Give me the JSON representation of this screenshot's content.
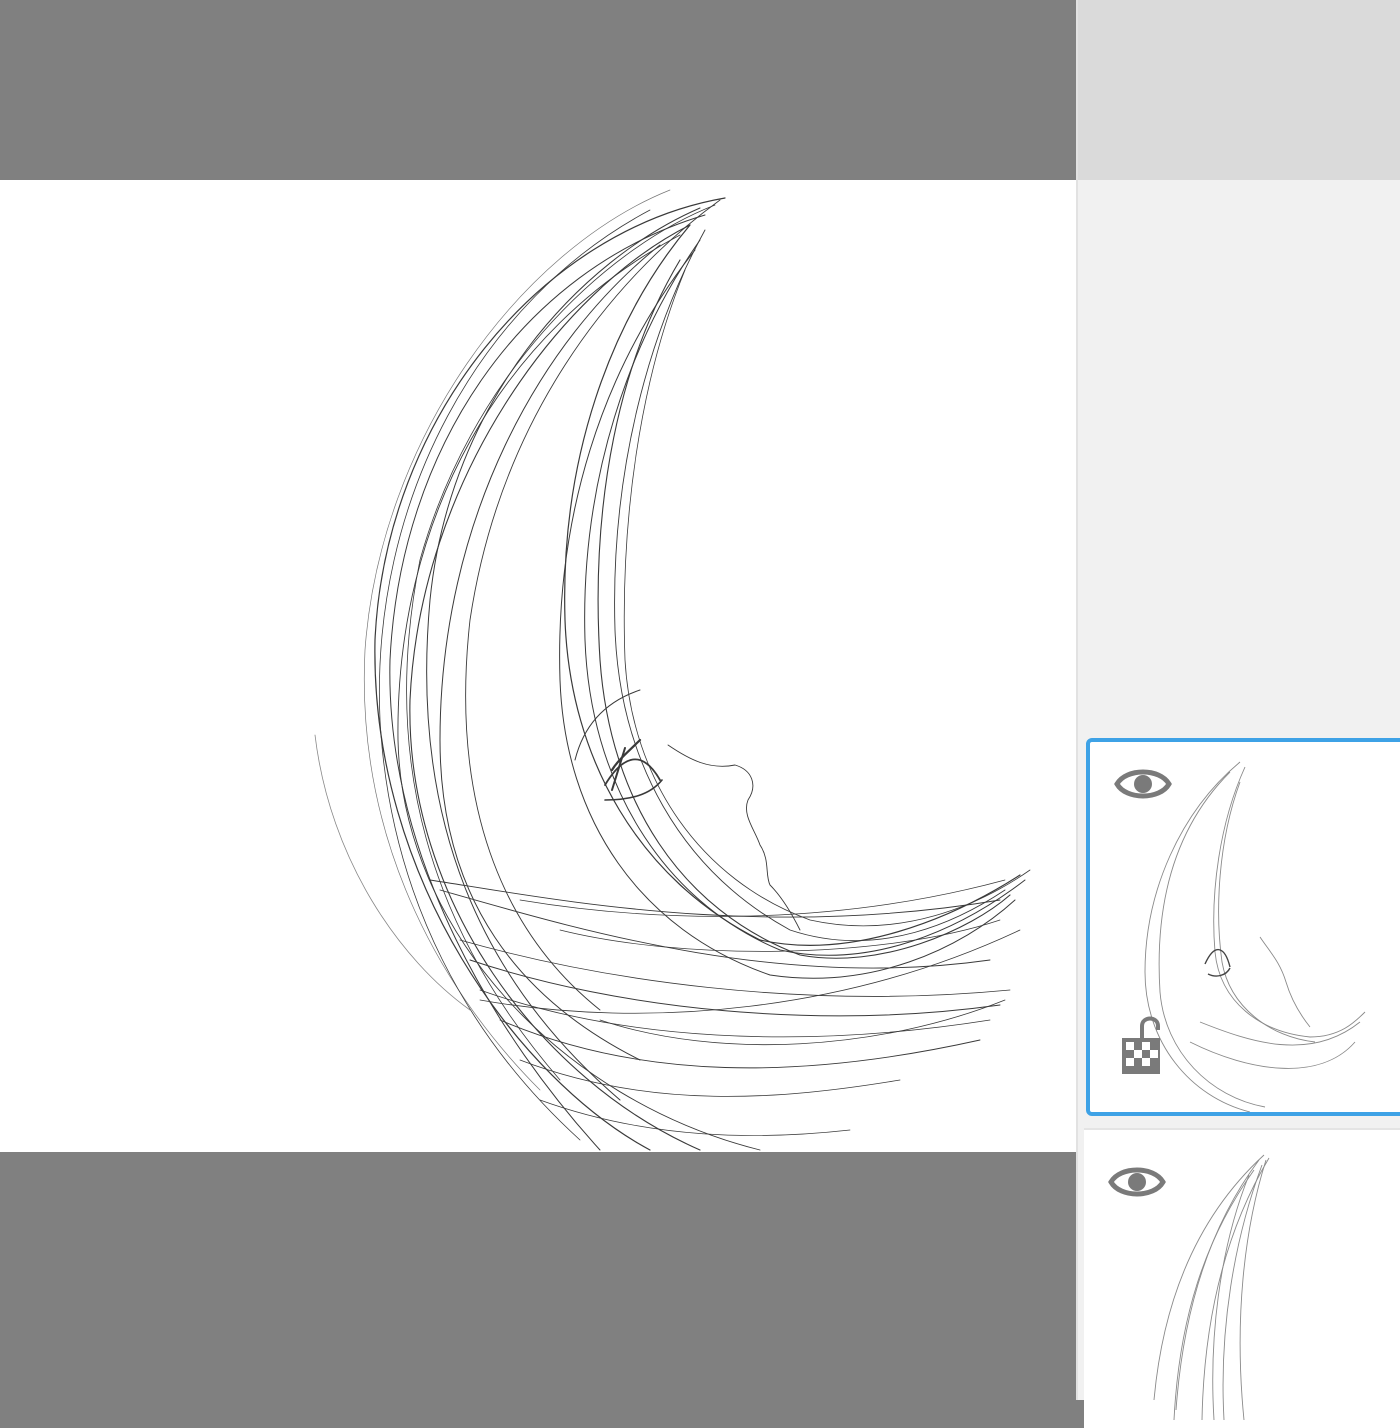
{
  "app": {
    "canvas_background": "#ffffff",
    "workspace_color": "#808080"
  },
  "layers_panel": {
    "selected_color": "#3ea2e6",
    "layers": [
      {
        "visibility_icon": "eye-icon",
        "lock_icon": "alpha-lock-icon",
        "selected": true
      },
      {
        "visibility_icon": "eye-icon",
        "selected": false
      }
    ]
  }
}
